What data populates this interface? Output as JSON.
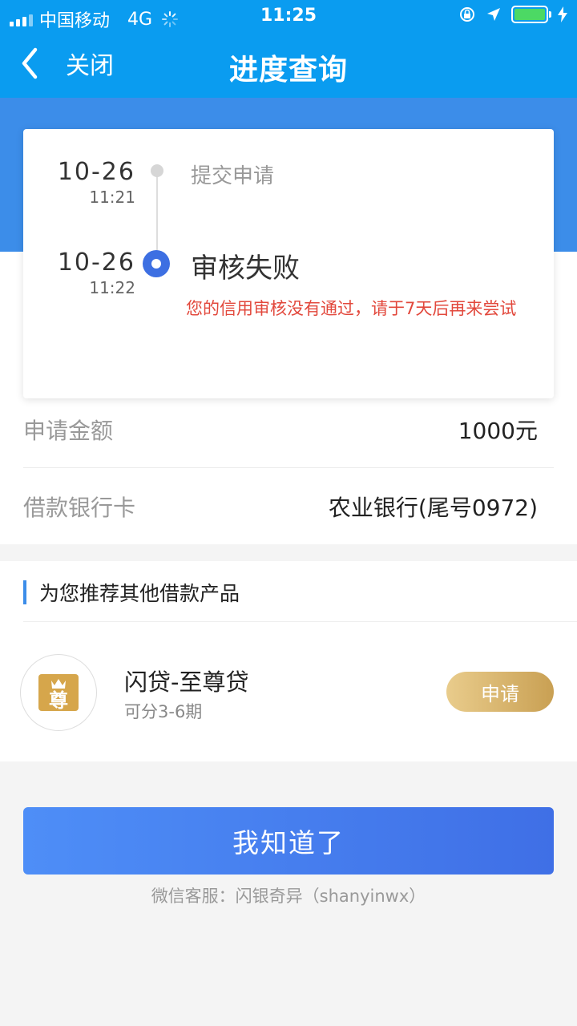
{
  "status_bar": {
    "carrier": "中国移动",
    "network": "4G",
    "time": "11:25"
  },
  "nav": {
    "back_label": "关闭",
    "title": "进度查询"
  },
  "timeline": [
    {
      "date": "10-26",
      "time": "11:21",
      "label": "提交申请"
    },
    {
      "date": "10-26",
      "time": "11:22",
      "label": "审核失败",
      "note": "您的信用审核没有通过，请于7天后再来尝试"
    }
  ],
  "info": {
    "amount_label": "申请金额",
    "amount_value": "1000元",
    "bank_label": "借款银行卡",
    "bank_value": "农业银行(尾号0972)"
  },
  "recommend": {
    "title": "为您推荐其他借款产品",
    "product": {
      "logo_text": "尊",
      "name": "闪贷-至尊贷",
      "terms": "可分3-6期",
      "apply_label": "申请"
    }
  },
  "confirm_label": "我知道了",
  "service_text": "微信客服：闪银奇异（shanyinwx）",
  "colors": {
    "header_blue": "#0a9cf0",
    "band_blue": "#3c8de9",
    "error_red": "#e2483c",
    "gold": "#c9a053"
  }
}
